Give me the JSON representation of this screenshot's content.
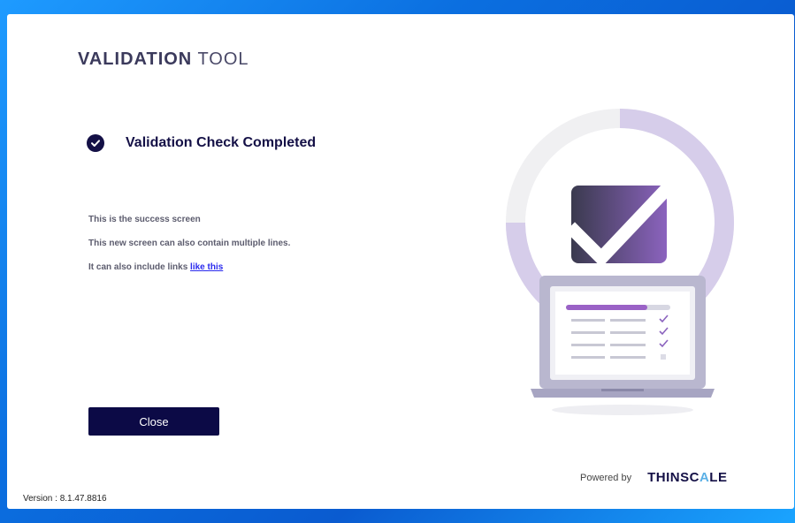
{
  "app": {
    "title_bold": "VALIDATION",
    "title_light": " TOOL"
  },
  "status": {
    "text": "Validation Check Completed",
    "icon": "check-circle-icon"
  },
  "messages": {
    "line1": "This is the success screen",
    "line2": "This new screen can also contain multiple lines.",
    "line3_prefix": "It can also include links ",
    "line3_link": "like this"
  },
  "actions": {
    "close_label": "Close"
  },
  "footer": {
    "powered_by": "Powered by",
    "brand_part1": "THINSC",
    "brand_part2": "A",
    "brand_part3": "LE",
    "version": "Version : 8.1.47.8816"
  },
  "colors": {
    "accent": "#141046",
    "link": "#2a2aee",
    "ring": "#d6cdea",
    "ring_light": "#f0f0f2",
    "card_gradient_start": "#3a3a4e",
    "card_gradient_end": "#8b63be"
  }
}
